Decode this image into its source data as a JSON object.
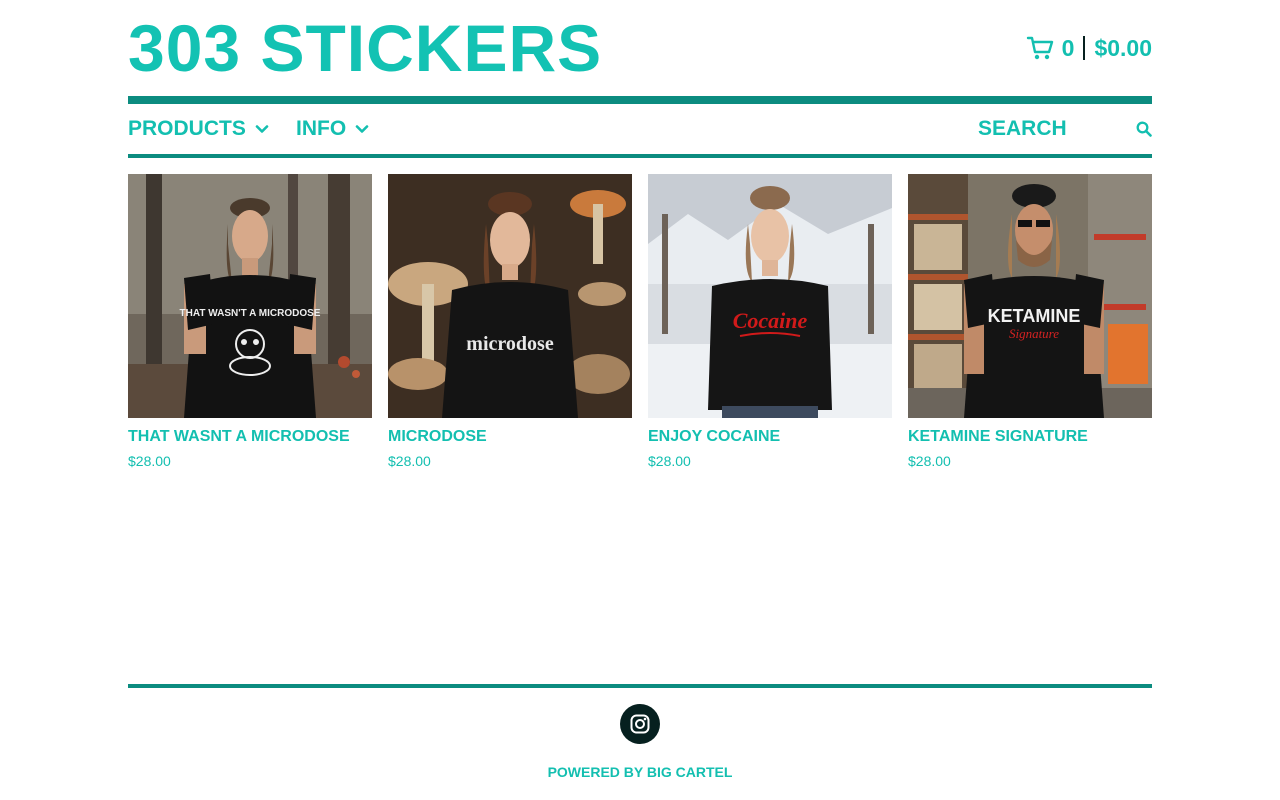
{
  "store": {
    "title": "303 STICKERS"
  },
  "cart": {
    "count": "0",
    "total": "$0.00",
    "icon": "shopping-cart-icon"
  },
  "nav": {
    "items": [
      {
        "label": "PRODUCTS",
        "icon": "chevron-down-icon"
      },
      {
        "label": "INFO",
        "icon": "chevron-down-icon"
      }
    ],
    "search": {
      "placeholder": "SEARCH",
      "icon": "search-icon"
    }
  },
  "products": [
    {
      "name": "THAT WASNT A MICRODOSE",
      "price": "$28.00",
      "shirt_text": "THAT WASN'T A MICRODOSE"
    },
    {
      "name": "MICRODOSE",
      "price": "$28.00",
      "shirt_text": "microdose"
    },
    {
      "name": "ENJOY COCAINE",
      "price": "$28.00",
      "shirt_text": "Cocaine"
    },
    {
      "name": "KETAMINE SIGNATURE",
      "price": "$28.00",
      "shirt_text": "KETAMINE",
      "shirt_subtext": "Signature"
    }
  ],
  "footer": {
    "social_icon": "instagram-icon",
    "powered_by": "POWERED BY BIG CARTEL"
  },
  "colors": {
    "accent": "#13bfb0",
    "rule": "#0c8c80",
    "dark": "#06201f"
  }
}
